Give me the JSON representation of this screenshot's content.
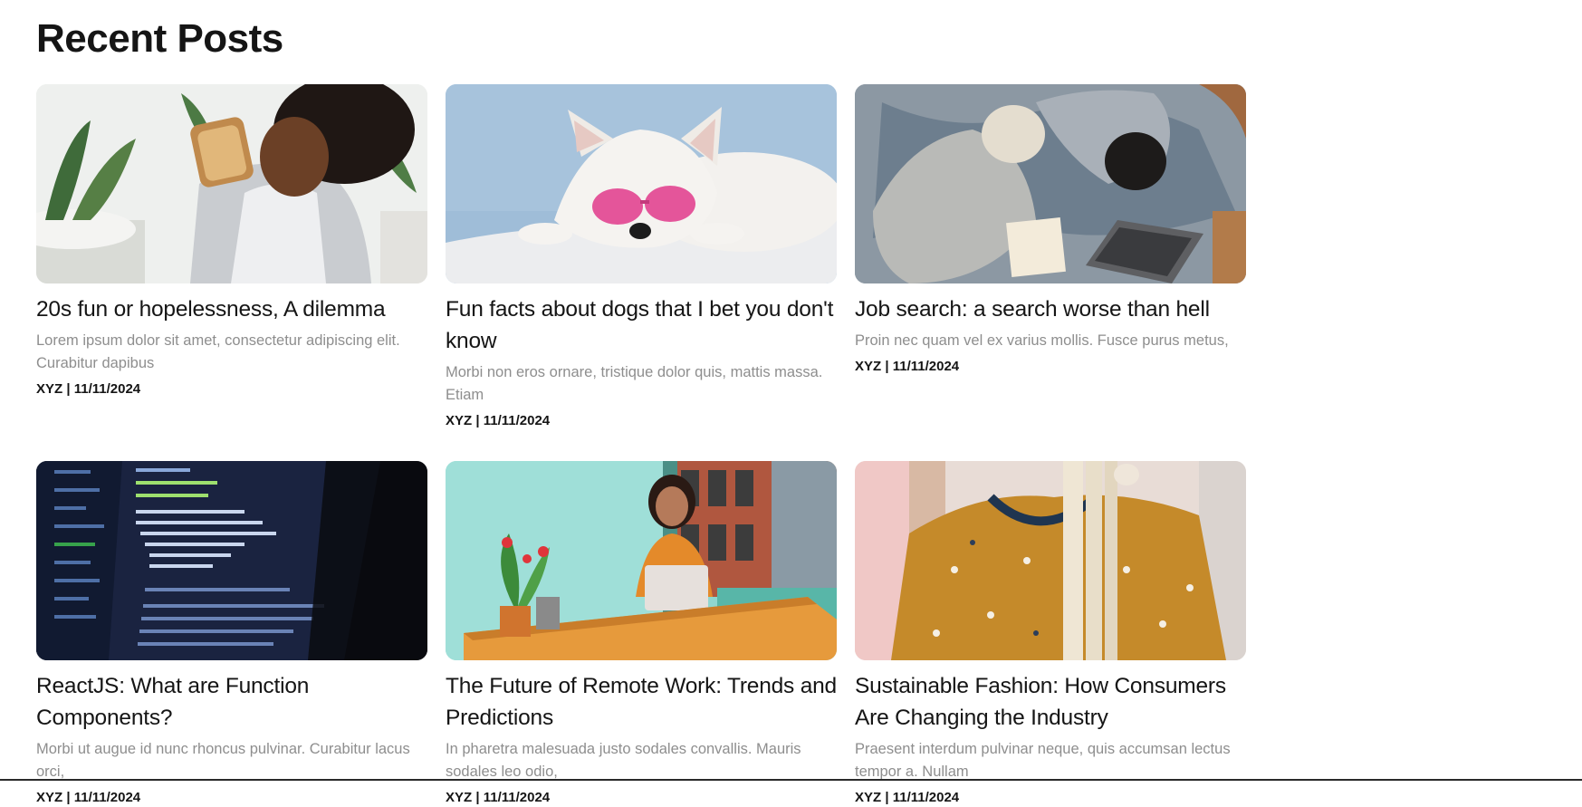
{
  "page": {
    "title": "Recent Posts"
  },
  "posts": [
    {
      "title": "20s fun or hopelessness, A dilemma",
      "excerpt": "Lorem ipsum dolor sit amet, consectetur adipiscing elit. Curabitur dapibus",
      "author": "XYZ",
      "separator": "|",
      "date": "11/11/2024",
      "image": "woman-eating-toast-photo"
    },
    {
      "title": "Fun facts about dogs that I bet you don't know",
      "excerpt": "Morbi non eros ornare, tristique dolor quis, mattis massa. Etiam",
      "author": "XYZ",
      "separator": "|",
      "date": "11/11/2024",
      "image": "white-dog-pink-sunglasses-photo"
    },
    {
      "title": "Job search: a search worse than hell",
      "excerpt": "Proin nec quam vel ex varius mollis. Fusce purus metus,",
      "author": "XYZ",
      "separator": "|",
      "date": "11/11/2024",
      "image": "two-people-on-rug-laptop-photo"
    },
    {
      "title": "ReactJS: What are Function Components?",
      "excerpt": "Morbi ut augue id nunc rhoncus pulvinar. Curabitur lacus orci,",
      "author": "XYZ",
      "separator": "|",
      "date": "11/11/2024",
      "image": "code-editor-screen-photo"
    },
    {
      "title": "The Future of Remote Work: Trends and Predictions",
      "excerpt": "In pharetra malesuada justo sodales convallis. Mauris sodales leo odio,",
      "author": "XYZ",
      "separator": "|",
      "date": "11/11/2024",
      "image": "woman-laptop-teal-wall-photo"
    },
    {
      "title": "Sustainable Fashion: How Consumers Are Changing the Industry",
      "excerpt": "Praesent interdum pulvinar neque, quis accumsan lectus tempor a. Nullam",
      "author": "XYZ",
      "separator": "|",
      "date": "11/11/2024",
      "image": "floral-dress-on-hanger-photo"
    }
  ]
}
